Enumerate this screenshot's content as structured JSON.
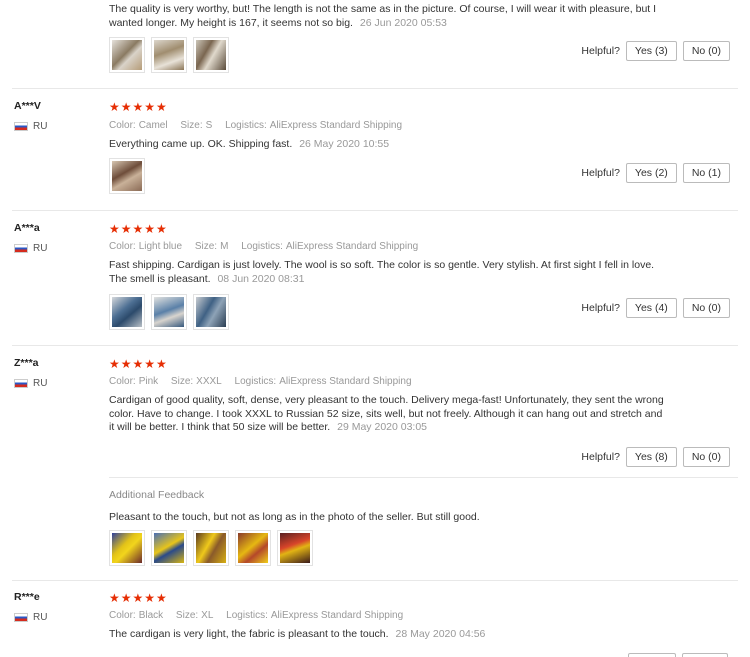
{
  "helpful_label": "Helpful?",
  "reviews": [
    {
      "text": "The quality is very worthy, but! The length is not the same as in the picture. Of course, I will wear it with pleasure, but I wanted longer. My height is 167, it seems not so big.",
      "date": "26 Jun 2020 05:53",
      "yes": "Yes (3)",
      "no": "No (0)"
    },
    {
      "user": "A***V",
      "country": "RU",
      "stars": "★★★★★",
      "color_label": "Color:",
      "color": "Camel",
      "size_label": "Size:",
      "size": "S",
      "logistics_label": "Logistics:",
      "logistics": "AliExpress Standard Shipping",
      "text": "Everything came up. OK. Shipping fast.",
      "date": "26 May 2020 10:55",
      "yes": "Yes (2)",
      "no": "No (1)"
    },
    {
      "user": "A***a",
      "country": "RU",
      "stars": "★★★★★",
      "color_label": "Color:",
      "color": "Light blue",
      "size_label": "Size:",
      "size": "M",
      "logistics_label": "Logistics:",
      "logistics": "AliExpress Standard Shipping",
      "text": "Fast shipping. Cardigan is just lovely. The wool is so soft. The color is so gentle. Very stylish. At first sight I fell in love. The smell is pleasant.",
      "date": "08 Jun 2020 08:31",
      "yes": "Yes (4)",
      "no": "No (0)"
    },
    {
      "user": "Z***a",
      "country": "RU",
      "stars": "★★★★★",
      "color_label": "Color:",
      "color": "Pink",
      "size_label": "Size:",
      "size": "XXXL",
      "logistics_label": "Logistics:",
      "logistics": "AliExpress Standard Shipping",
      "text": "Cardigan of good quality, soft, dense, very pleasant to the touch. Delivery mega-fast! Unfortunately, they sent the wrong color. Have to change. I took XXXL to Russian 52 size, sits well, but not freely. Although it can hang out and stretch and it will be better. I think that 50 size will be better.",
      "date": "29 May 2020 03:05",
      "yes": "Yes (8)",
      "no": "No (0)",
      "additional_label": "Additional Feedback",
      "additional_text": "Pleasant to the touch, but not as long as in the photo of the seller. But still good."
    },
    {
      "user": "R***e",
      "country": "RU",
      "stars": "★★★★★",
      "color_label": "Color:",
      "color": "Black",
      "size_label": "Size:",
      "size": "XL",
      "logistics_label": "Logistics:",
      "logistics": "AliExpress Standard Shipping",
      "text": "The cardigan is very light, the fabric is pleasant to the touch.",
      "date": "28 May 2020 04:56"
    }
  ]
}
